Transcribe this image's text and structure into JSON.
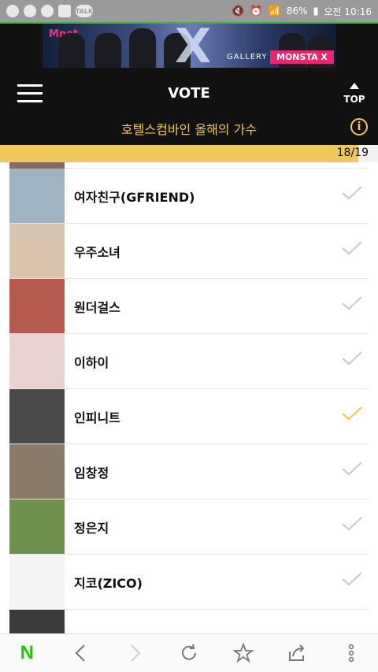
{
  "status_bar": {
    "battery": "86%",
    "time": "오전 10:16",
    "talk_badge": "TALK"
  },
  "banner": {
    "brand": "Mnet",
    "gallery_label": "GALLERY",
    "tag": "MONSTA X"
  },
  "header": {
    "title": "VOTE",
    "top_label": "TOP",
    "subtitle": "호텔스컴바인 올해의 가수"
  },
  "progress": {
    "counter": "18/19",
    "value": 0.947
  },
  "accent_color": "#f0c95c",
  "artists": [
    {
      "name": "여자친구(GFRIEND)",
      "selected": false,
      "thumb_color": "#9fb3c2"
    },
    {
      "name": "우주소녀",
      "selected": false,
      "thumb_color": "#d9c4b0"
    },
    {
      "name": "원더걸스",
      "selected": false,
      "thumb_color": "#b55a4d"
    },
    {
      "name": "이하이",
      "selected": false,
      "thumb_color": "#e7d3cf"
    },
    {
      "name": "인피니트",
      "selected": true,
      "thumb_color": "#4a4a4a"
    },
    {
      "name": "임창정",
      "selected": false,
      "thumb_color": "#8a7a6a"
    },
    {
      "name": "정은지",
      "selected": false,
      "thumb_color": "#6f8f4f"
    },
    {
      "name": "지코(ZICO)",
      "selected": false,
      "thumb_color": "#f4f4f4"
    }
  ],
  "bottom_nav": [
    "naver-home",
    "back",
    "forward",
    "refresh",
    "bookmark",
    "share",
    "more"
  ]
}
